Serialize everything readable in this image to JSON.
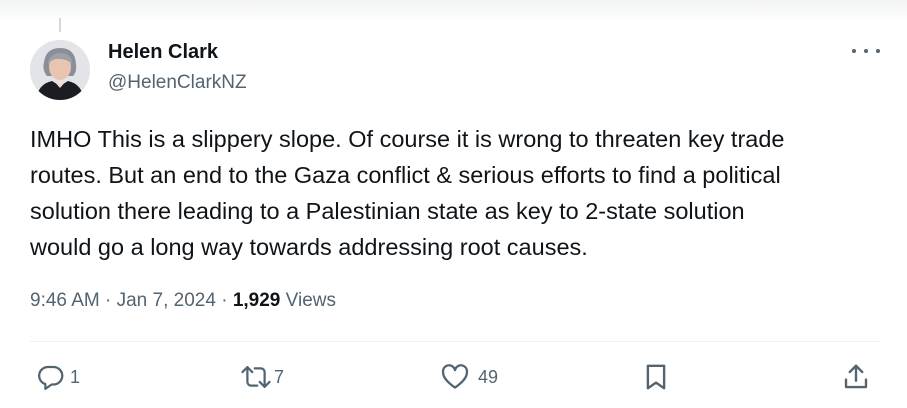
{
  "author": {
    "name": "Helen Clark",
    "handle": "@HelenClarkNZ"
  },
  "tweet": {
    "lines": [
      "IMHO This is a slippery slope. Of course it is wrong to threaten key trade",
      "routes. But an end to the Gaza conflict & serious efforts to find a political",
      "solution there leading to a Palestinian state as key to 2-state solution",
      "would go a long way towards addressing root causes."
    ]
  },
  "meta": {
    "time": "9:46 AM",
    "separator": " · ",
    "date": "Jan 7, 2024",
    "views_count": "1,929",
    "views_label": " Views"
  },
  "actions": {
    "replies": "1",
    "reposts": "7",
    "likes": "49"
  },
  "icons": {
    "reply": "reply-icon",
    "repost": "repost-icon",
    "like": "heart-icon",
    "bookmark": "bookmark-icon",
    "share": "share-icon",
    "more": "more-icon"
  },
  "colors": {
    "text": "#0f1419",
    "secondary": "#536471",
    "divider": "#eff3f4"
  }
}
